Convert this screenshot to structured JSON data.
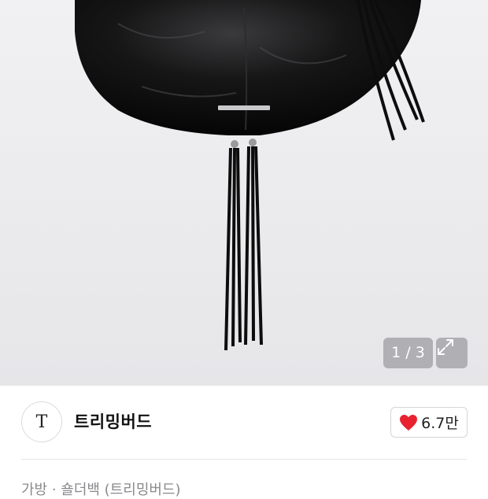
{
  "product": {
    "image_alt": "black leather hobo bag with tassels",
    "image_counter": "1 / 3"
  },
  "icons": {
    "expand": "expand-icon",
    "heart": "heart-icon",
    "heart_color": "#e8232f"
  },
  "brand": {
    "logo_text": "T",
    "name": "트리밍버드",
    "likes": "6.7만"
  },
  "breadcrumb": {
    "text": "가방 · 숄더백 (트리밍버드)"
  }
}
